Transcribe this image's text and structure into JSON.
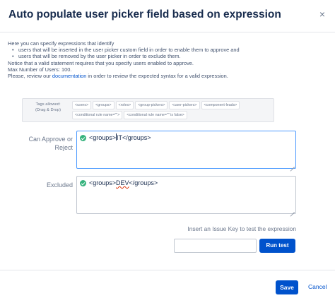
{
  "dialog": {
    "title": "Auto populate user picker field based on expression",
    "close_label": "×"
  },
  "intro": {
    "line1": "Here you can specify expressions that identify",
    "bullet1": "users that will be inserted in the user picker custom field in order to enable them to approve and",
    "bullet2": "users that will be removed by the user picker in order to exclude them.",
    "line2": "Notice that a valid statement requires that you specify users enabled to approve.",
    "line3": "Max Number of Users: 100.",
    "line4_prefix": "Please, review our ",
    "line4_link": "documentation",
    "line4_suffix": " in order to review the expected syntax for a valid expression."
  },
  "tags": {
    "label_line1": "Tags allowed:",
    "label_line2": "(Drag & Drop)",
    "items": [
      "<users>",
      "<groups>",
      "<roles>",
      "<group-pickers>",
      "<user-pickers>",
      "<component-leads>",
      "<conditional rule name=\"\">",
      "<conditional rule name=\"\" is false>"
    ]
  },
  "approve": {
    "label_line1": "Can Approve or",
    "label_line2": "Reject",
    "code_before_caret": "<groups>",
    "code_after_caret": "IT</groups>"
  },
  "excluded": {
    "label": "Excluded",
    "code_open": "<groups>",
    "code_value": "DEV",
    "code_close": "</groups>"
  },
  "test": {
    "label": "Insert an Issue Key to test the expression",
    "input_value": "",
    "input_placeholder": "",
    "button_label": "Run test"
  },
  "footer": {
    "save_label": "Save",
    "cancel_label": "Cancel"
  },
  "colors": {
    "primary": "#0052cc",
    "success": "#36b37e",
    "focus_border": "#4c9aff",
    "error_underline": "#de350b"
  },
  "icons": {
    "close": "close-icon",
    "valid": "check-circle-icon",
    "resize": "resize-handle-icon"
  }
}
